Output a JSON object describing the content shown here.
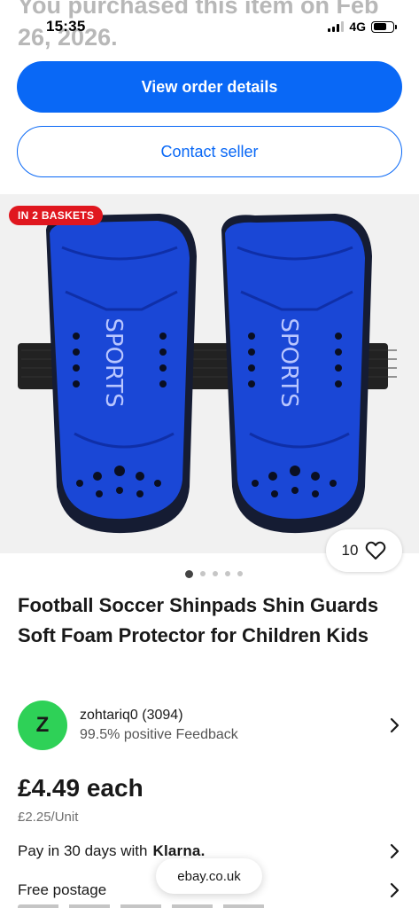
{
  "header": {
    "purchased_text": "You purchased this item on Feb 26, 2026."
  },
  "status_bar": {
    "time": "15:35",
    "network": "4G"
  },
  "actions": {
    "view_order": "View order details",
    "contact_seller": "Contact seller"
  },
  "gallery": {
    "badge": "IN 2 BASKETS",
    "product_print": "SPORTS",
    "watch_count": "10",
    "image_count": 5,
    "active_index": 0,
    "colors": {
      "guard": "#1a47d6",
      "strap": "#222222",
      "backdrop": "#f1f1f1"
    }
  },
  "listing": {
    "title": "Football Soccer Shinpads Shin Guards Soft Foam Protector for Children Kids",
    "price": "£4.49 each",
    "unit_price": "£2.25/Unit"
  },
  "seller": {
    "initial": "Z",
    "name": "zohtariq0 (3094)",
    "feedback": "99.5% positive Feedback"
  },
  "payment": {
    "text": "Pay in 30 days with",
    "brand": "Klarna."
  },
  "postage": {
    "text": "Free postage"
  },
  "browser": {
    "url": "ebay.co.uk"
  },
  "theme": {
    "primary": "#0968f6",
    "badge_red": "#e0171f",
    "avatar_green": "#2ed157"
  }
}
